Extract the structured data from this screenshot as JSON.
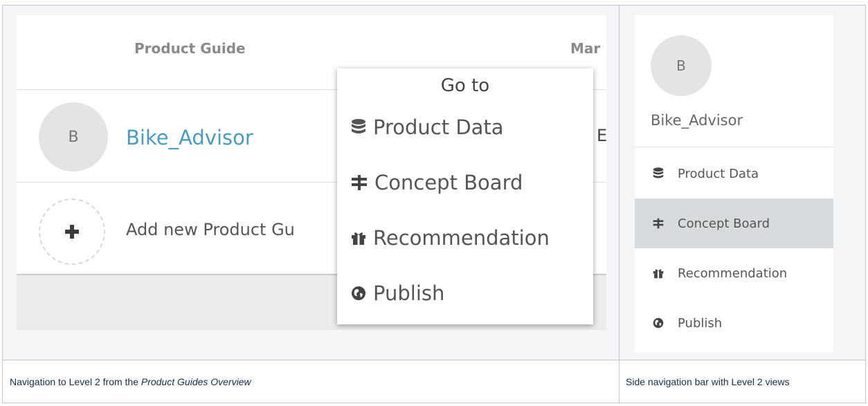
{
  "left_view": {
    "headers": [
      "Product Guide",
      "Mar"
    ],
    "guide": {
      "avatar_letter": "B",
      "name": "Bike_Advisor",
      "trailing": "E"
    },
    "add_row": {
      "icon": "plus-icon",
      "label": "Add new Product Gu"
    },
    "dropdown": {
      "title": "Go to",
      "items": [
        {
          "label": "Product Data",
          "icon": "database-icon"
        },
        {
          "label": "Concept Board",
          "icon": "signpost-icon"
        },
        {
          "label": "Recommendation",
          "icon": "gift-icon"
        },
        {
          "label": "Publish",
          "icon": "globe-icon"
        }
      ]
    }
  },
  "right_view": {
    "avatar_letter": "B",
    "name": "Bike_Advisor",
    "items": [
      {
        "label": "Product Data",
        "icon": "database-icon",
        "active": false
      },
      {
        "label": "Concept Board",
        "icon": "signpost-icon",
        "active": true
      },
      {
        "label": "Recommendation",
        "icon": "gift-icon",
        "active": false
      },
      {
        "label": "Publish",
        "icon": "globe-icon",
        "active": false
      }
    ]
  },
  "captions": {
    "left_prefix": "Navigation to Level 2 from the ",
    "left_emphasis": "Product Guides Overview",
    "right": "Side navigation bar with Level 2 views"
  },
  "colors": {
    "link": "#4a9bbf",
    "active_item": "#d7dbdd",
    "table_border": "#c1c7d0",
    "cell_bg": "#f4f5f7"
  }
}
